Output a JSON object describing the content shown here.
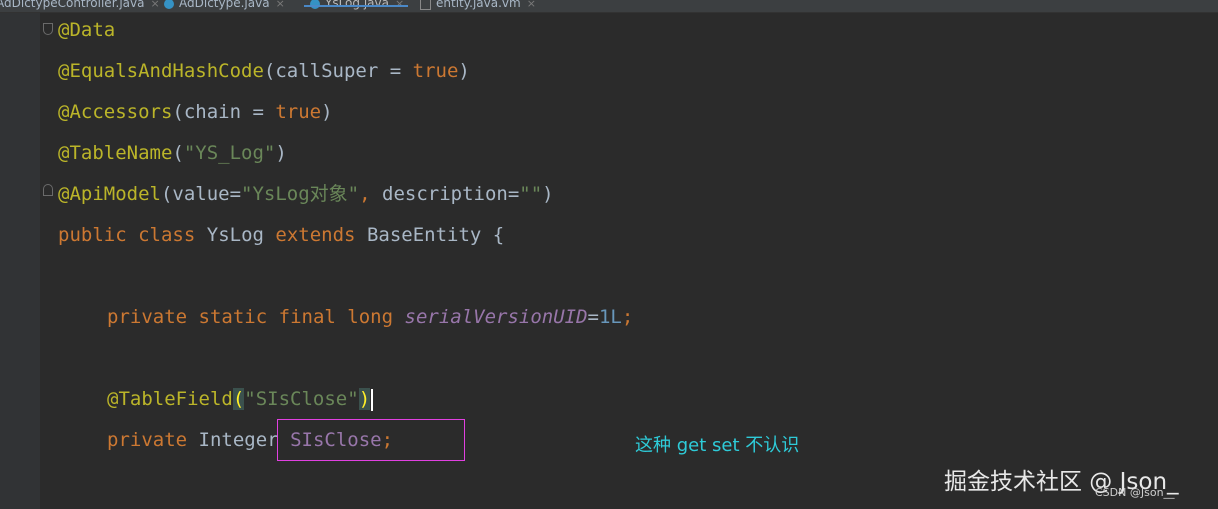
{
  "tabs": [
    {
      "label": "AdDictypeController.java",
      "active": false
    },
    {
      "label": "AdDictype.java",
      "active": false
    },
    {
      "label": "YsLog.java",
      "active": true
    },
    {
      "label": "entity.java.vm",
      "active": false
    }
  ],
  "tab_close_glyph": "×",
  "code": {
    "l1": {
      "ann": "@Data"
    },
    "l2": {
      "ann": "@EqualsAndHashCode",
      "open": "(callSuper = ",
      "val": "true",
      "close": ")"
    },
    "l3": {
      "ann": "@Accessors",
      "open": "(chain = ",
      "val": "true",
      "close": ")"
    },
    "l4": {
      "ann": "@TableName",
      "open": "(",
      "str": "\"YS_Log\"",
      "close": ")"
    },
    "l5": {
      "ann": "@ApiModel",
      "p1": "(value=",
      "s1": "\"YsLog对象\"",
      "comma": ", ",
      "p2": "description=",
      "s2": "\"\"",
      "close": ")"
    },
    "l6": {
      "kw1": "public",
      "kw2": "class",
      "name": "YsLog",
      "kw3": "extends",
      "base": "BaseEntity",
      "brace": "{"
    },
    "l7": {
      "kw1": "private",
      "kw2": "static",
      "kw3": "final",
      "kw4": "long",
      "field": "serialVersionUID",
      "eq": "=",
      "num": "1L",
      "semi": ";"
    },
    "l8": {
      "ann": "@TableField",
      "open": "(",
      "str": "\"SIsClose\"",
      "close": ")"
    },
    "l9": {
      "kw1": "private",
      "type": "Integer",
      "field": "SIsClose",
      "semi": ";"
    }
  },
  "annotation_note": "这种 get set 不认识",
  "watermark": "掘金技术社区 @ Json_",
  "watermark_small": "CSDN @Json__",
  "colors": {
    "background": "#2b2b2b",
    "annotation": "#bbb529",
    "keyword": "#cc7832",
    "string": "#6a8759",
    "field": "#9876aa",
    "number": "#6897bb",
    "highlight_box": "#e040e0",
    "note_text": "#2ecbd8"
  }
}
